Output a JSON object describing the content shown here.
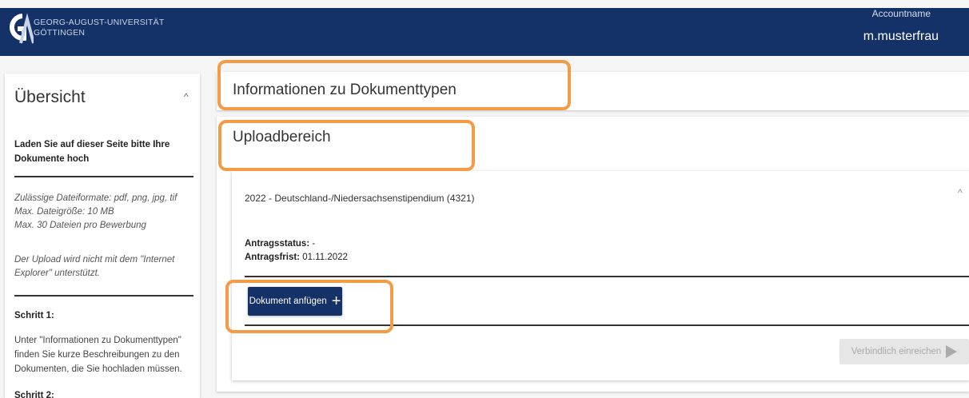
{
  "header": {
    "university_line1": "GEORG-AUGUST-UNIVERSITÄT",
    "university_line2": "GÖTTINGEN",
    "account_label": "Accountname",
    "account_name": "m.musterfrau"
  },
  "sidebar": {
    "title": "Übersicht",
    "intro": "Laden Sie auf dieser Seite bitte Ihre Dokumente hoch",
    "formats": "Zulässige Dateiformate: pdf, png, jpg, tif",
    "max_size": "Max. Dateigröße: 10 MB",
    "max_files": "Max. 30 Dateien pro Bewerbung",
    "ie_note": "Der Upload wird nicht mit dem \"Internet Explorer\" unterstützt.",
    "step1_title": "Schritt 1:",
    "step1_text": "Unter \"Informationen zu Dokumenttypen\" finden Sie kurze Beschreibungen zu den Dokumenten, die Sie hochladen müssen.",
    "step2_title": "Schritt 2:"
  },
  "main": {
    "info_title": "Informationen zu Dokumenttypen",
    "upload_title": "Uploadbereich",
    "application": {
      "name": "2022 - Deutschland-/Niedersachsenstipendium (4321)",
      "status_label": "Antragsstatus:",
      "status_value": "-",
      "deadline_label": "Antragsfrist:",
      "deadline_value": "01.11.2022",
      "add_document_label": "Dokument anfügen",
      "submit_label": "Verbindlich einreichen"
    }
  },
  "colors": {
    "header_bg": "#153268",
    "highlight": "#f39c45",
    "button_bg": "#153268"
  }
}
